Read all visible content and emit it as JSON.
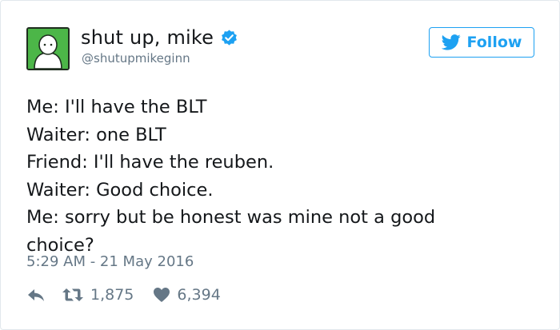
{
  "author": {
    "display_name": "shut up, mike",
    "handle": "@shutupmikeginn",
    "verified": true
  },
  "follow_button": {
    "label": "Follow"
  },
  "tweet": {
    "lines": [
      "Me: I'll have the BLT",
      "Waiter: one BLT",
      "Friend: I'll have the reuben.",
      "Waiter: Good choice.",
      "Me: sorry but be honest was mine not a good",
      "choice?"
    ],
    "timestamp": "5:29 AM - 21 May 2016"
  },
  "stats": {
    "retweets": "1,875",
    "likes": "6,394"
  },
  "colors": {
    "accent": "#1da1f2",
    "avatar_bg": "#4cb648",
    "meta_text": "#657786"
  },
  "icons": {
    "avatar": "cartoon-avatar-icon",
    "verified": "verified-badge-icon",
    "follow": "twitter-bird-icon",
    "reply": "reply-arrow-icon",
    "retweet": "retweet-icon",
    "like": "heart-icon"
  }
}
